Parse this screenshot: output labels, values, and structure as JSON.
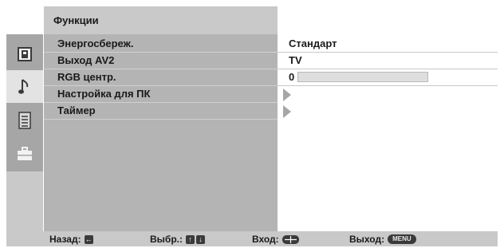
{
  "header": {
    "title": "Функции"
  },
  "sidebar": {
    "icons": [
      {
        "name": "picture-icon",
        "selected": false
      },
      {
        "name": "sound-note-icon",
        "selected": true
      },
      {
        "name": "channel-list-icon",
        "selected": false
      },
      {
        "name": "toolbox-icon",
        "selected": false
      }
    ]
  },
  "menu": {
    "items": [
      {
        "label": "Энергосбереж.",
        "value": "Стандарт"
      },
      {
        "label": "Выход AV2",
        "value": "TV"
      },
      {
        "label": "RGB центр.",
        "value": "0",
        "level": 0.0
      },
      {
        "label": "Настройка для ПК",
        "value": ""
      },
      {
        "label": "Таймер",
        "value": ""
      }
    ]
  },
  "footer": {
    "back_label": "Назад:",
    "select_label": "Выбр.:",
    "enter_label": "Вход:",
    "exit_label": "Выход:",
    "menu_key": "MENU"
  }
}
